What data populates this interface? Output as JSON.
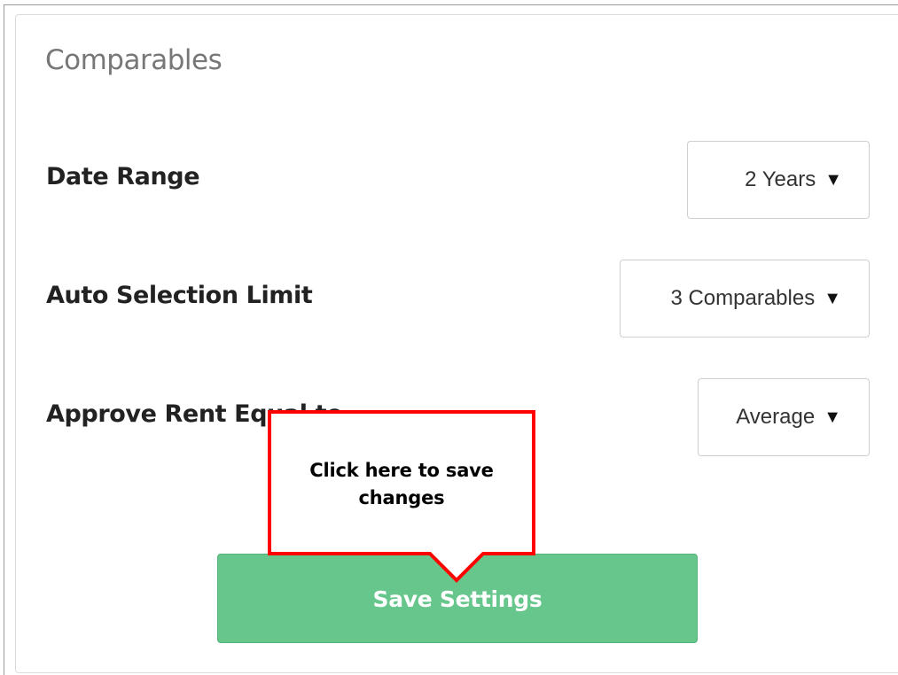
{
  "panel": {
    "title": "Comparables"
  },
  "settings": [
    {
      "label": "Date Range",
      "value": "2 Years"
    },
    {
      "label": "Auto Selection Limit",
      "value": "3 Comparables"
    },
    {
      "label": "Approve Rent Equal to",
      "value": "Average"
    }
  ],
  "select_arrow": "▼",
  "save_button": {
    "label": "Save Settings"
  },
  "callout": {
    "text": "Click here to save changes",
    "border_color": "#ff0000"
  },
  "colors": {
    "save_button_bg": "#66c68b",
    "title_text": "#777777"
  }
}
